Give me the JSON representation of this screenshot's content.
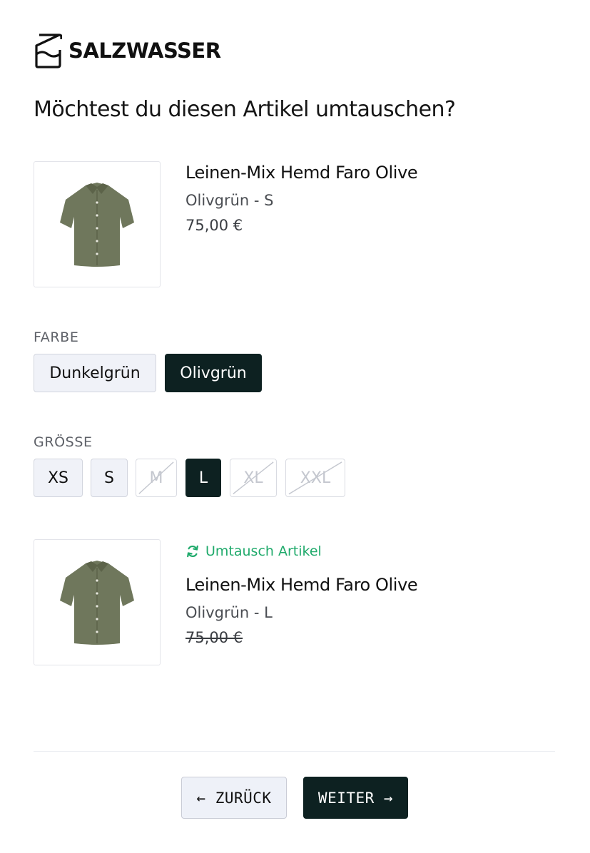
{
  "brand": {
    "name": "SALZWASSER"
  },
  "page": {
    "question": "Möchtest du diesen Artikel umtauschen?"
  },
  "original_item": {
    "title": "Leinen-Mix Hemd Faro Olive",
    "variant": "Olivgrün - S",
    "price": "75,00 €",
    "image_icon": "shirt-icon"
  },
  "color": {
    "label": "FARBE",
    "options": [
      {
        "label": "Dunkelgrün",
        "state": "default"
      },
      {
        "label": "Olivgrün",
        "state": "selected"
      }
    ]
  },
  "size": {
    "label": "GRÖSSE",
    "options": [
      {
        "label": "XS",
        "state": "default"
      },
      {
        "label": "S",
        "state": "default"
      },
      {
        "label": "M",
        "state": "disabled"
      },
      {
        "label": "L",
        "state": "selected"
      },
      {
        "label": "XL",
        "state": "disabled"
      },
      {
        "label": "XXL",
        "state": "disabled"
      }
    ]
  },
  "exchange_item": {
    "tag": "Umtausch Artikel",
    "title": "Leinen-Mix Hemd Faro Olive",
    "variant": "Olivgrün - L",
    "price": "75,00 €",
    "image_icon": "shirt-icon"
  },
  "footer": {
    "back_label": "← ZURÜCK",
    "next_label": "WEITER →"
  },
  "colors": {
    "primary": "#0d2121",
    "accent_green": "#1faa6b",
    "shirt_olive": "#6f775c"
  }
}
